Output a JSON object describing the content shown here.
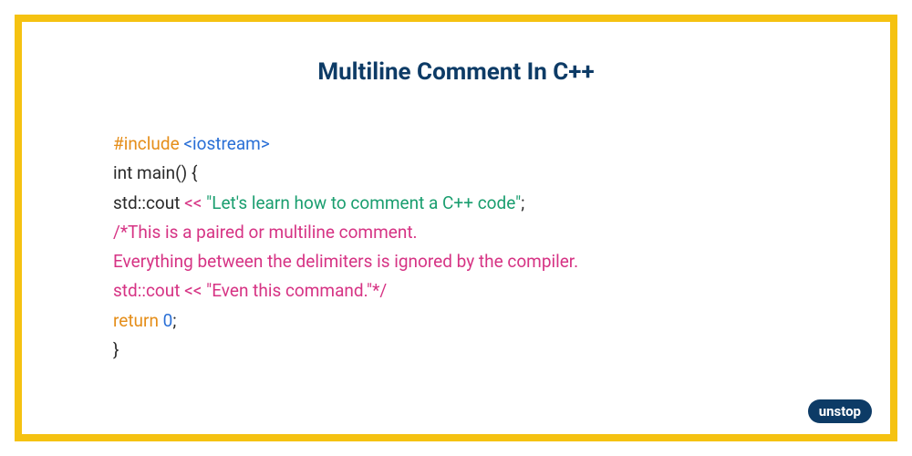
{
  "title": "Multiline Comment In C++",
  "code": {
    "line1": {
      "include": "#include ",
      "header": "<iostream>"
    },
    "line2": "int main() {",
    "line3": {
      "cout": "std::cout ",
      "op": "<< ",
      "str": "\"Let's learn how to comment a C++ code\"",
      "semi": ";"
    },
    "line4": "/*This is a paired or multiline comment.",
    "line5": "Everything between the delimiters is ignored by the compiler.",
    "line6": "std::cout << \"Even this command.\"*/",
    "line7": {
      "ret": "return ",
      "zero": "0",
      "semi": ";"
    },
    "line8": "}"
  },
  "logo": {
    "un": "un",
    "stop": "stop"
  }
}
